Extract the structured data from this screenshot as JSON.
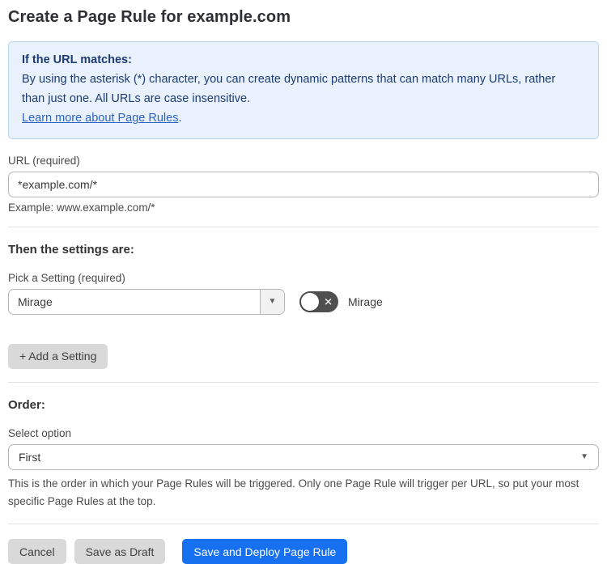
{
  "page": {
    "title": "Create a Page Rule for example.com"
  },
  "info_box": {
    "heading": "If the URL matches:",
    "body": "By using the asterisk (*) character, you can create dynamic patterns that can match many URLs, rather than just one. All URLs are case insensitive.",
    "link": "Learn more about Page Rules",
    "link_suffix": "."
  },
  "url_field": {
    "label": "URL (required)",
    "value": "*example.com/*",
    "helper": "Example: www.example.com/*"
  },
  "settings_section": {
    "heading": "Then the settings are:",
    "picker_label": "Pick a Setting (required)",
    "picker_value": "Mirage",
    "caret": "▼",
    "toggle_state": "off",
    "toggle_glyph": "✕",
    "toggle_label": "Mirage",
    "add_button": "+ Add a Setting"
  },
  "order_section": {
    "heading": "Order:",
    "select_label": "Select option",
    "select_value": "First",
    "caret": "▼",
    "helper": "This is the order in which your Page Rules will be triggered. Only one Page Rule will trigger per URL, so put your most specific Page Rules at the top."
  },
  "footer": {
    "cancel": "Cancel",
    "save_draft": "Save as Draft",
    "save_deploy": "Save and Deploy Page Rule"
  },
  "colors": {
    "accent_blue": "#1670f0",
    "info_bg": "#e9f2fc",
    "info_border": "#b5d3f3",
    "info_text": "#1d3b72",
    "link_blue": "#2a62c4",
    "toggle_off_bg": "#4f4f4f",
    "button_gray": "#d9d9d9"
  }
}
